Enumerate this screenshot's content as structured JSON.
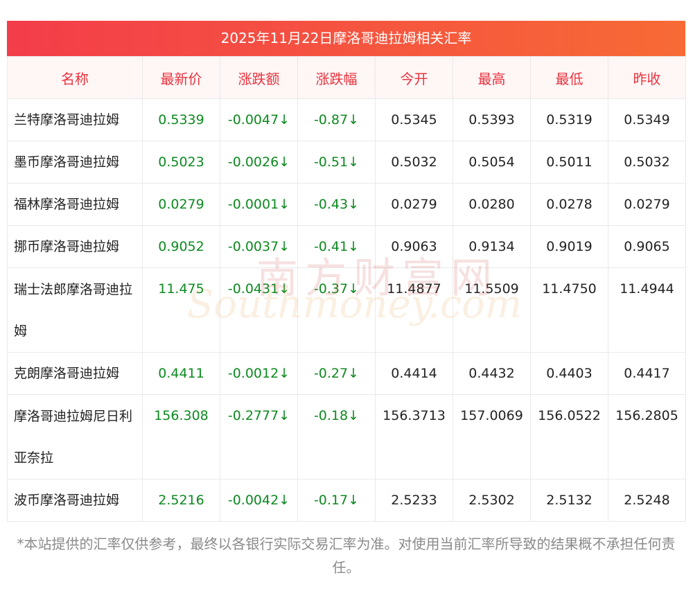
{
  "title": "2025年11月22日摩洛哥迪拉姆相关汇率",
  "columns": [
    "名称",
    "最新价",
    "涨跌额",
    "涨跌幅",
    "今开",
    "最高",
    "最低",
    "昨收"
  ],
  "rows": [
    {
      "name": "兰特摩洛哥迪拉姆",
      "latest": "0.5339",
      "change": "-0.0047",
      "pct": "-0.87",
      "open": "0.5345",
      "high": "0.5393",
      "low": "0.5319",
      "prev": "0.5349"
    },
    {
      "name": "墨币摩洛哥迪拉姆",
      "latest": "0.5023",
      "change": "-0.0026",
      "pct": "-0.51",
      "open": "0.5032",
      "high": "0.5054",
      "low": "0.5011",
      "prev": "0.5032"
    },
    {
      "name": "福林摩洛哥迪拉姆",
      "latest": "0.0279",
      "change": "-0.0001",
      "pct": "-0.43",
      "open": "0.0279",
      "high": "0.0280",
      "low": "0.0278",
      "prev": "0.0279"
    },
    {
      "name": "挪币摩洛哥迪拉姆",
      "latest": "0.9052",
      "change": "-0.0037",
      "pct": "-0.41",
      "open": "0.9063",
      "high": "0.9134",
      "low": "0.9019",
      "prev": "0.9065"
    },
    {
      "name": "瑞士法郎摩洛哥迪拉姆",
      "latest": "11.475",
      "change": "-0.0431",
      "pct": "-0.37",
      "open": "11.4877",
      "high": "11.5509",
      "low": "11.4750",
      "prev": "11.4944"
    },
    {
      "name": "克朗摩洛哥迪拉姆",
      "latest": "0.4411",
      "change": "-0.0012",
      "pct": "-0.27",
      "open": "0.4414",
      "high": "0.4432",
      "low": "0.4403",
      "prev": "0.4417"
    },
    {
      "name": "摩洛哥迪拉姆尼日利亚奈拉",
      "latest": "156.308",
      "change": "-0.2777",
      "pct": "-0.18",
      "open": "156.3713",
      "high": "157.0069",
      "low": "156.0522",
      "prev": "156.2805"
    },
    {
      "name": "波币摩洛哥迪拉姆",
      "latest": "2.5216",
      "change": "-0.0042",
      "pct": "-0.17",
      "open": "2.5233",
      "high": "2.5302",
      "low": "2.5132",
      "prev": "2.5248"
    }
  ],
  "arrow_down": "↓",
  "footnote": "*本站提供的汇率仅供参考，最终以各银行实际交易汇率为准。对使用当前汇率所导致的结果概不承担任何责任。",
  "watermark": {
    "cn": "南方财富网",
    "en": "Southmoney.com"
  },
  "colors": {
    "header_text": "#e8343e",
    "title_bg_start": "#f33d4a",
    "title_bg_end": "#f76a35",
    "down": "#0c8a1f"
  }
}
